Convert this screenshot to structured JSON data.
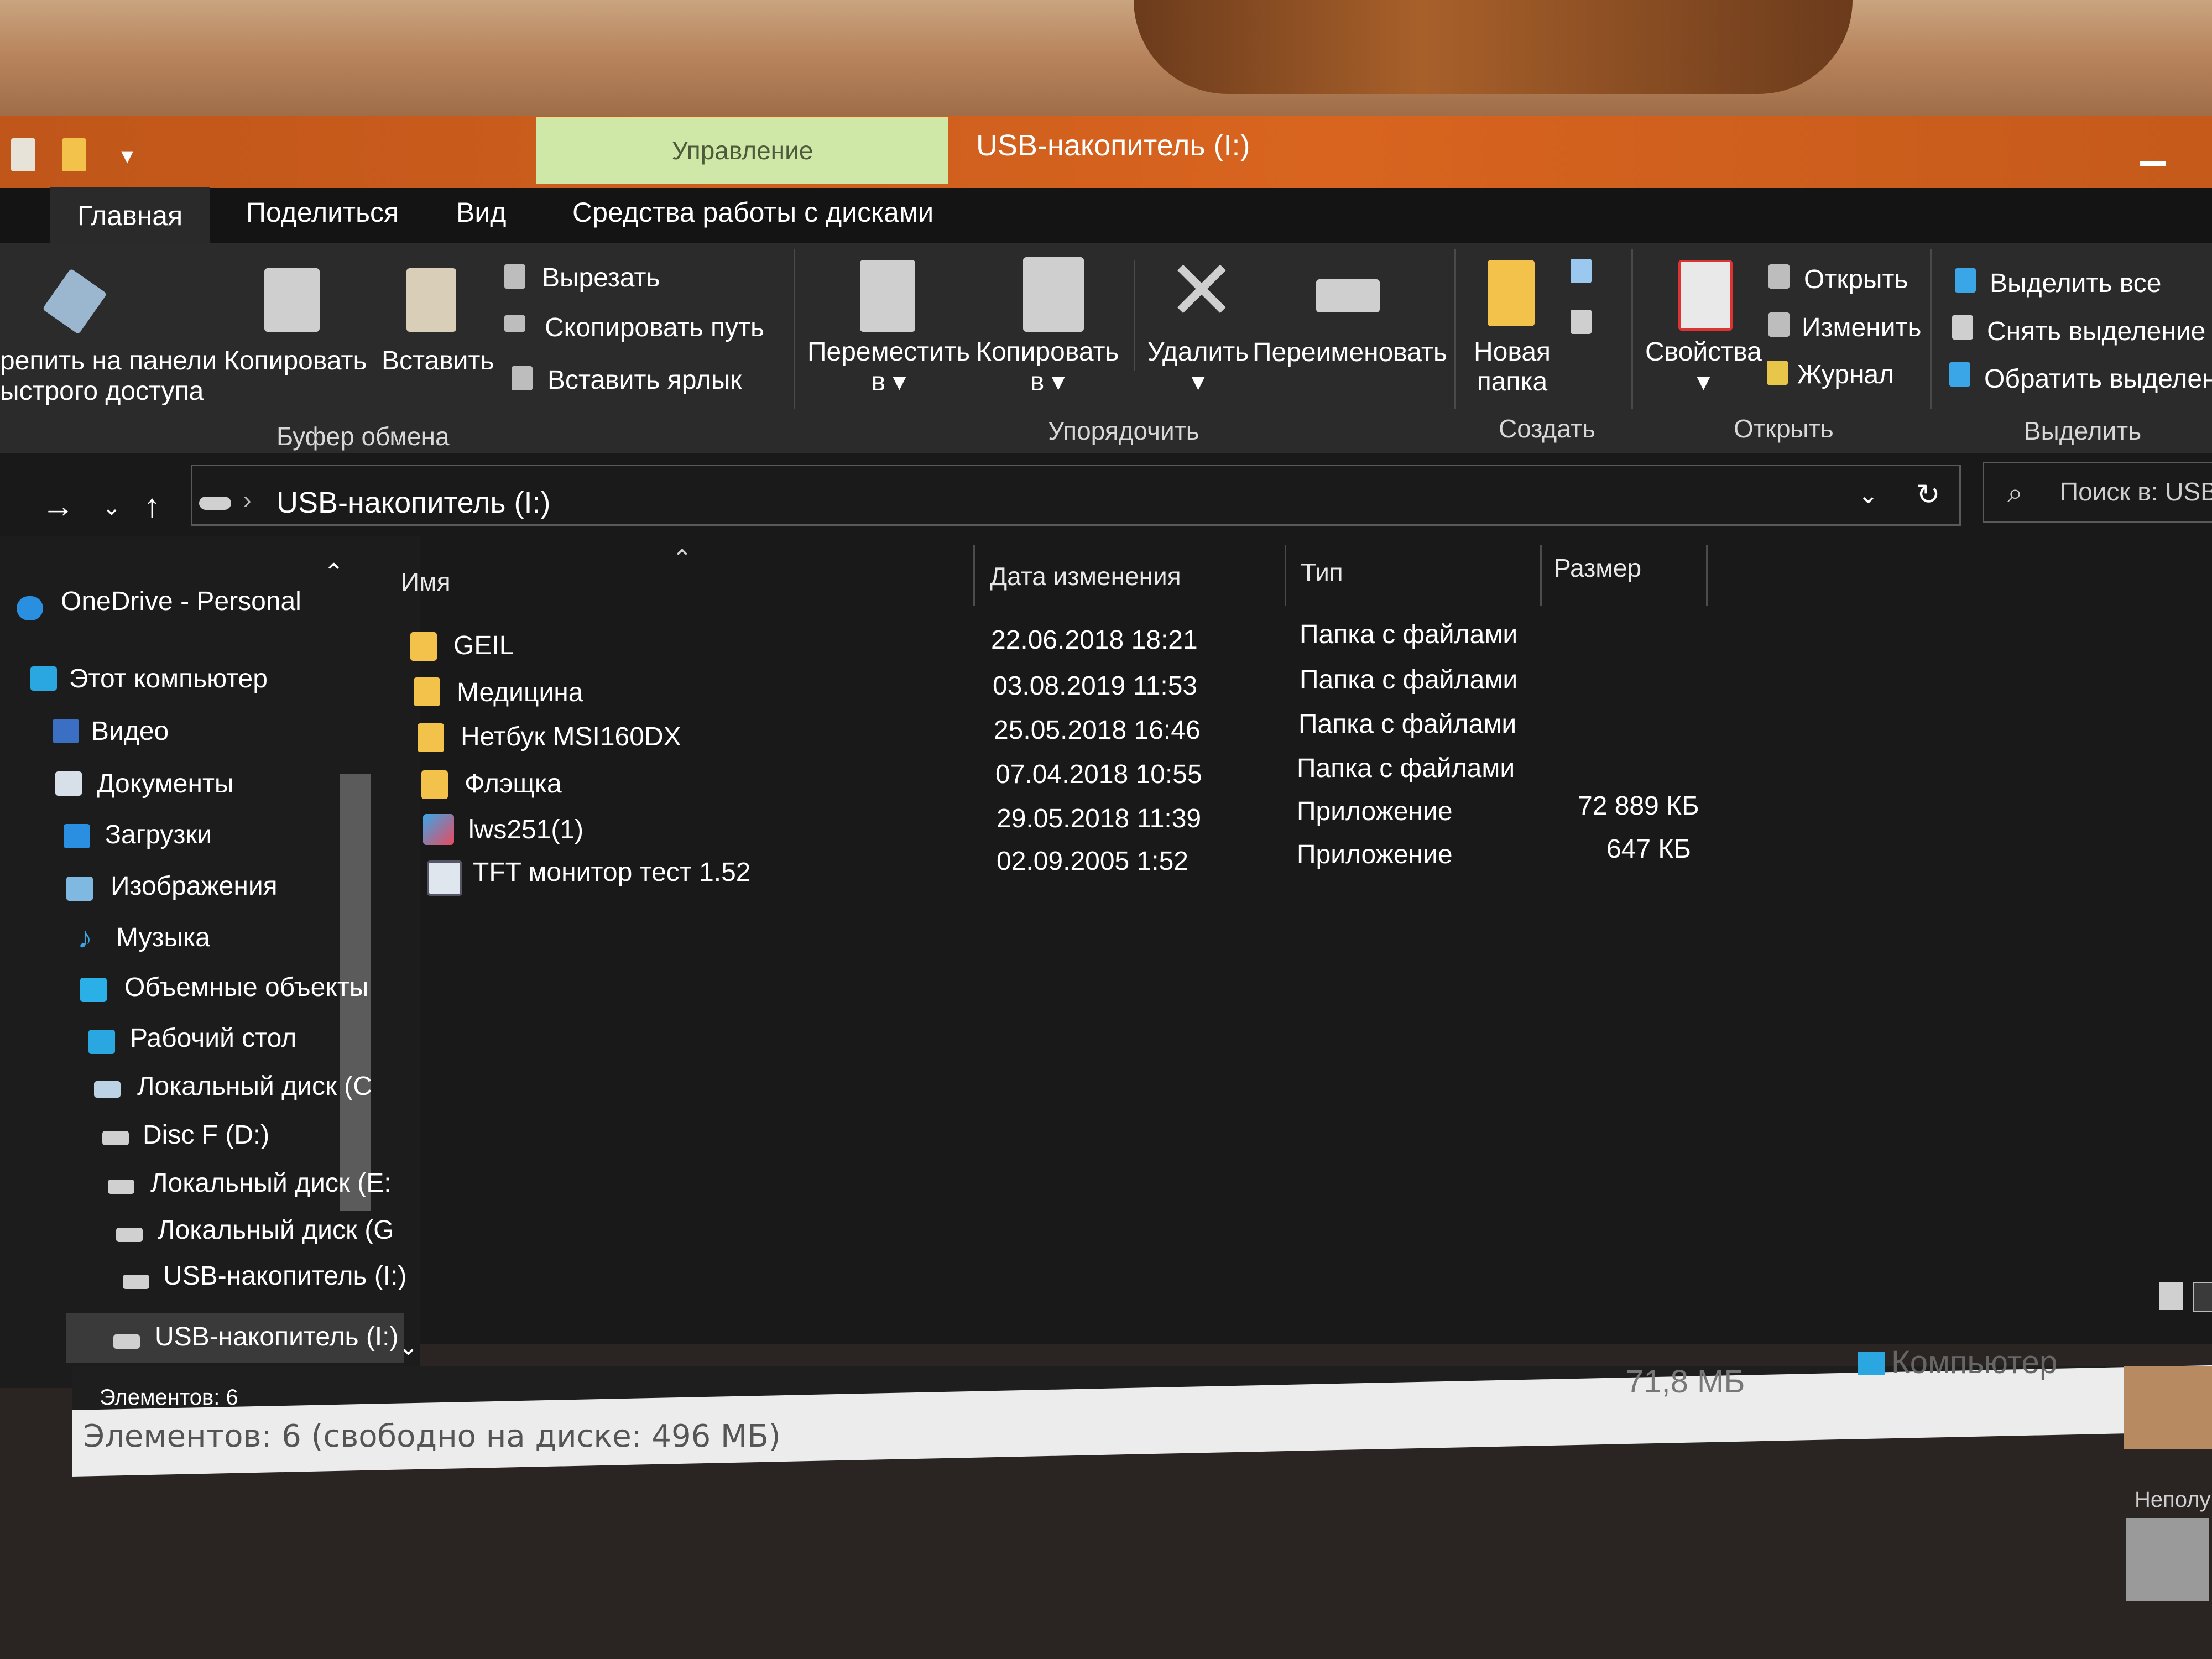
{
  "titlebar": {
    "manage_tab": "Управление",
    "window_title": "USB-накопитель (I:)"
  },
  "ribbon_tabs": {
    "home": "Главная",
    "share": "Поделиться",
    "view": "Вид",
    "disk_tools": "Средства работы с дисками"
  },
  "clipboard": {
    "pin_line1": "репить на панели",
    "pin_line2": "ыстрого доступа",
    "copy": "Копировать",
    "paste": "Вставить",
    "cut": "Вырезать",
    "copy_path": "Скопировать путь",
    "paste_shortcut": "Вставить ярлык",
    "group": "Буфер обмена"
  },
  "organize": {
    "move_to_1": "Переместить",
    "move_to_2": "в ▾",
    "copy_to_1": "Копировать",
    "copy_to_2": "в ▾",
    "delete": "Удалить",
    "delete_arrow": "▾",
    "rename": "Переименовать",
    "group": "Упорядочить"
  },
  "create": {
    "new_folder_1": "Новая",
    "new_folder_2": "папка",
    "group": "Создать"
  },
  "open": {
    "properties": "Свойства",
    "properties_arrow": "▾",
    "open": "Открыть",
    "edit": "Изменить",
    "history": "Журнал",
    "group": "Открыть"
  },
  "select": {
    "select_all": "Выделить все",
    "select_none": "Снять выделение",
    "invert": "Обратить выделение",
    "group": "Выделить"
  },
  "address": {
    "path": "USB-накопитель (I:)",
    "search_placeholder": "Поиск в: USB-н"
  },
  "nav_pane": {
    "items": [
      "OneDrive - Personal",
      "Этот компьютер",
      "Видео",
      "Документы",
      "Загрузки",
      "Изображения",
      "Музыка",
      "Объемные объекты",
      "Рабочий стол",
      "Локальный диск (C",
      "Disc F (D:)",
      "Локальный диск (E:",
      "Локальный диск (G",
      "USB-накопитель (I:)",
      "USB-накопитель (I:)"
    ]
  },
  "columns": {
    "name": "Имя",
    "date": "Дата изменения",
    "type": "Тип",
    "size": "Размер"
  },
  "files": [
    {
      "name": "GEIL",
      "date": "22.06.2018 18:21",
      "type": "Папка с файлами",
      "size": ""
    },
    {
      "name": "Медицина",
      "date": "03.08.2019 11:53",
      "type": "Папка с файлами",
      "size": ""
    },
    {
      "name": "Нетбук MSI160DX",
      "date": "25.05.2018 16:46",
      "type": "Папка с файлами",
      "size": ""
    },
    {
      "name": "Флэщка",
      "date": "07.04.2018 10:55",
      "type": "Папка с файлами",
      "size": ""
    },
    {
      "name": "lws251(1)",
      "date": "29.05.2018 11:39",
      "type": "Приложение",
      "size": "72 889 КБ"
    },
    {
      "name": "TFT монитор тест 1.52",
      "date": "02.09.2005 1:52",
      "type": "Приложение",
      "size": "647 КБ"
    }
  ],
  "status": {
    "items_count": "Элементов: 6",
    "legacy_status": "Элементов: 6 (свободно на диске: 496 МБ)",
    "legacy_size": "71,8 МБ",
    "legacy_location": "Компьютер",
    "side_label": "Неполу"
  },
  "colors": {
    "accent_title": "#d8641f",
    "manage_tab": "#cfe8a8",
    "folder_icon": "#f2c24a"
  }
}
